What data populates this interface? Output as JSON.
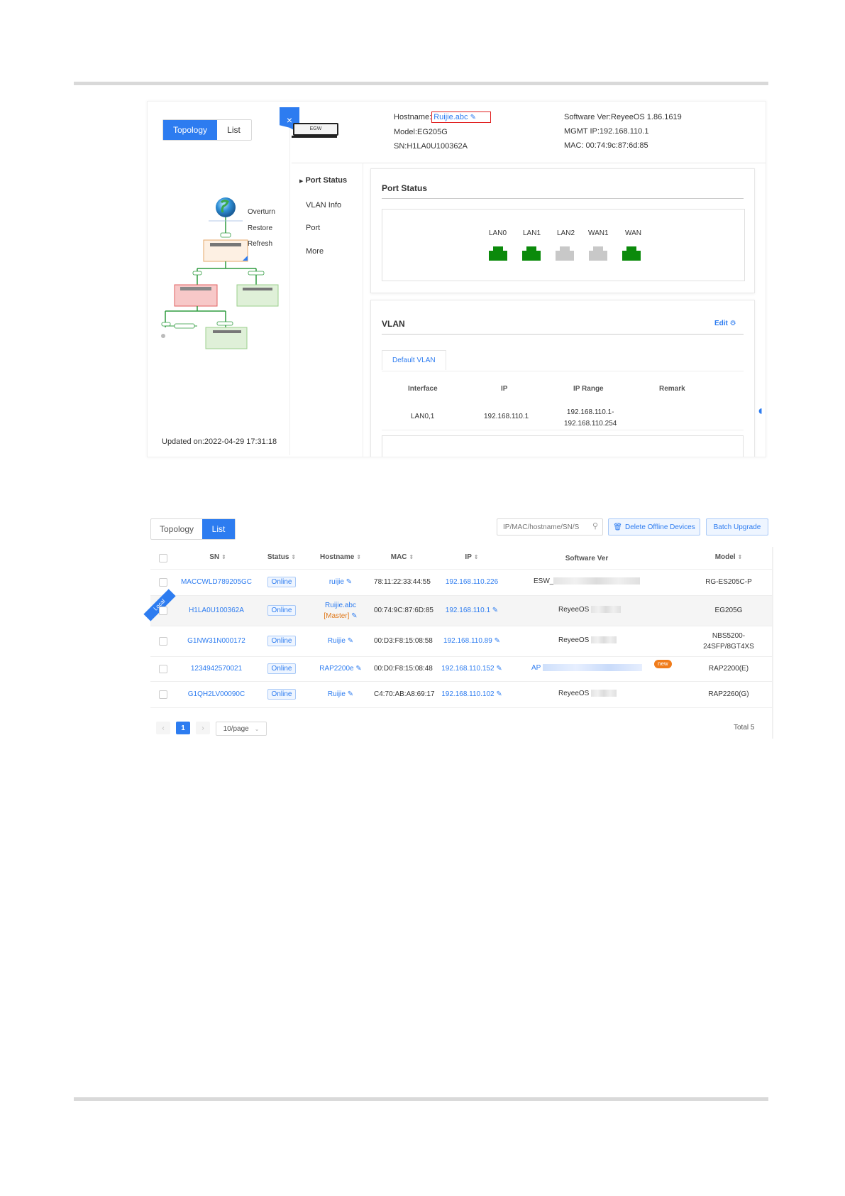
{
  "colors": {
    "accent": "#2d7cf0",
    "port_up": "#0b8a0b",
    "port_down": "#c8c8c8",
    "highlight_box": "#e02020",
    "master": "#e07b1f"
  },
  "topology_view": {
    "tabs": [
      "Topology",
      "List"
    ],
    "close_icon": "×",
    "device_image_label": "EGW",
    "topology_menu": [
      "Overturn",
      "Restore",
      "Refresh"
    ],
    "updated": "Updated on:2022-04-29 17:31:18",
    "device_info": {
      "hostname_label": "Hostname:",
      "hostname_value": "Ruijie.abc",
      "model": "Model:EG205G",
      "sn": "SN:H1LA0U100362A",
      "software": "Software Ver:ReyeeOS 1.86.1619",
      "mgmt_ip": "MGMT IP:192.168.110.1",
      "mac": "MAC: 00:74:9c:87:6d:85"
    },
    "side_menu": [
      "Port Status",
      "VLAN Info",
      "Port",
      "More"
    ],
    "port_status": {
      "title": "Port Status",
      "ports": [
        {
          "name": "LAN0",
          "state": "up"
        },
        {
          "name": "LAN1",
          "state": "up"
        },
        {
          "name": "LAN2",
          "state": "down"
        },
        {
          "name": "WAN1",
          "state": "down"
        },
        {
          "name": "WAN",
          "state": "up"
        }
      ]
    },
    "vlan": {
      "title": "VLAN",
      "edit": "Edit",
      "tab": "Default VLAN",
      "headers": [
        "Interface",
        "IP",
        "IP Range",
        "Remark"
      ],
      "row": {
        "interface": "LAN0,1",
        "ip": "192.168.110.1",
        "range1": "192.168.110.1-",
        "range2": "192.168.110.254",
        "remark": ""
      }
    }
  },
  "list_view": {
    "tabs": [
      "Topology",
      "List"
    ],
    "search_placeholder": "IP/MAC/hostname/SN/S",
    "delete_offline": "Delete Offline Devices",
    "batch_upgrade": "Batch Upgrade",
    "headers": [
      "SN",
      "Status",
      "Hostname",
      "MAC",
      "IP",
      "Software Ver",
      "Model"
    ],
    "local_ribbon": "Local",
    "rows": [
      {
        "sn": "MACCWLD789205GC",
        "status": "Online",
        "hostname": "ruijie",
        "hostname2": "",
        "mac": "78:11:22:33:44:55",
        "ip": "192.168.110.226",
        "software": "ESW_",
        "model": "RG-ES205C-P",
        "model2": "",
        "new": ""
      },
      {
        "sn": "H1LA0U100362A",
        "status": "Online",
        "hostname": "Ruijie.abc",
        "hostname2": "[Master]",
        "mac": "00:74:9C:87:6D:85",
        "ip": "192.168.110.1",
        "software": "ReyeeOS",
        "model": "EG205G",
        "model2": "",
        "new": ""
      },
      {
        "sn": "G1NW31N000172",
        "status": "Online",
        "hostname": "Ruijie",
        "hostname2": "",
        "mac": "00:D3:F8:15:08:58",
        "ip": "192.168.110.89",
        "software": "ReyeeOS",
        "model": "NBS5200-",
        "model2": "24SFP/8GT4XS",
        "new": ""
      },
      {
        "sn": "1234942570021",
        "status": "Online",
        "hostname": "RAP2200e",
        "hostname2": "",
        "mac": "00:D0:F8:15:08:48",
        "ip": "192.168.110.152",
        "software": "AP",
        "model": "RAP2200(E)",
        "model2": "",
        "new": "new"
      },
      {
        "sn": "G1QH2LV00090C",
        "status": "Online",
        "hostname": "Ruijie",
        "hostname2": "",
        "mac": "C4:70:AB:A8:69:17",
        "ip": "192.168.110.102",
        "software": "ReyeeOS",
        "model": "RAP2260(G)",
        "model2": "",
        "new": ""
      }
    ],
    "pagination": {
      "prev": "‹",
      "page": "1",
      "next": "›",
      "per_page": "10/page",
      "total": "Total 5"
    }
  }
}
